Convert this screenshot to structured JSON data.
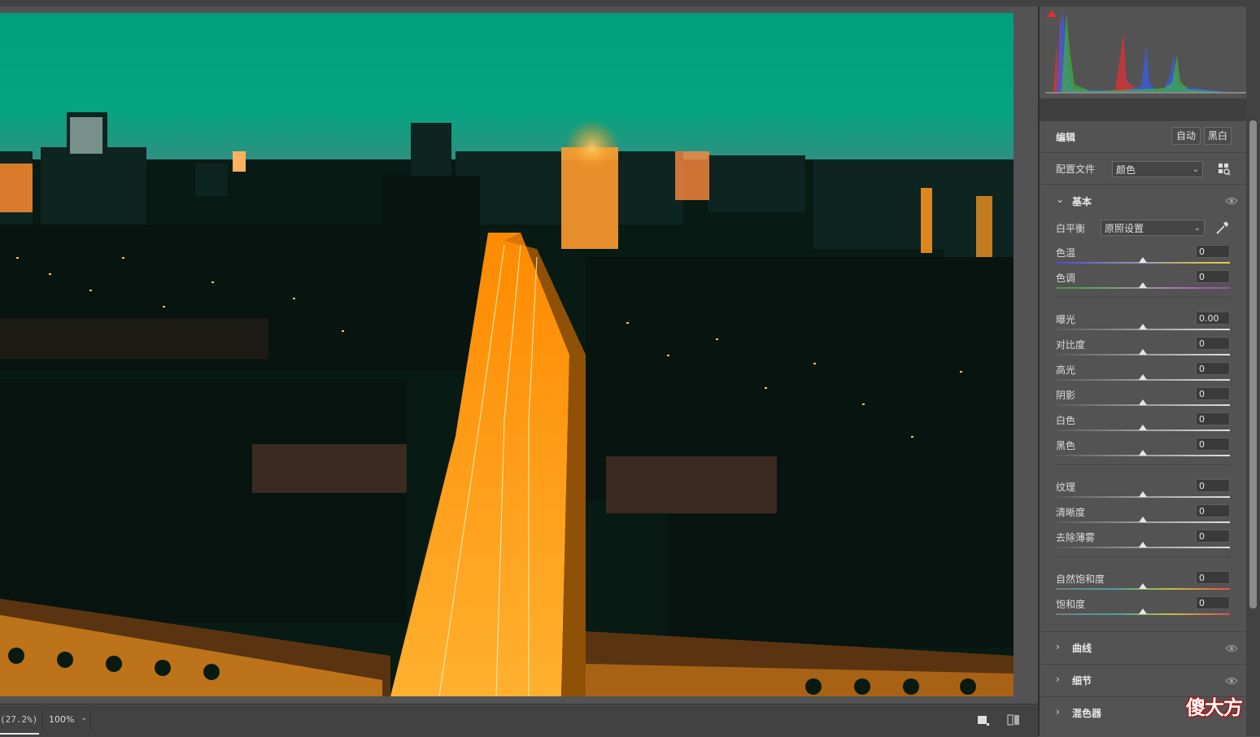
{
  "canvas": {
    "zoom_readout": "(27.2%)",
    "zoom_level": "100%"
  },
  "panel": {
    "edit_title": "编辑",
    "auto_button": "自动",
    "bw_button": "黑白",
    "profile_label": "配置文件",
    "profile_value": "颜色",
    "basic_section": "基本",
    "white_balance_label": "白平衡",
    "white_balance_value": "原照设置",
    "sliders": [
      {
        "label": "色温",
        "value": "0",
        "level": 0.5,
        "track": "temp"
      },
      {
        "label": "色调",
        "value": "0",
        "level": 0.5,
        "track": "tint"
      },
      {
        "label": "曝光",
        "value": "0.00",
        "level": 0.5,
        "track": "gray"
      },
      {
        "label": "对比度",
        "value": "0",
        "level": 0.5,
        "track": "gray"
      },
      {
        "label": "高光",
        "value": "0",
        "level": 0.5,
        "track": "gray"
      },
      {
        "label": "阴影",
        "value": "0",
        "level": 0.5,
        "track": "gray"
      },
      {
        "label": "白色",
        "value": "0",
        "level": 0.5,
        "track": "gray"
      },
      {
        "label": "黑色",
        "value": "0",
        "level": 0.5,
        "track": "gray"
      },
      {
        "label": "纹理",
        "value": "0",
        "level": 0.5,
        "track": "gray"
      },
      {
        "label": "清晰度",
        "value": "0",
        "level": 0.5,
        "track": "gray"
      },
      {
        "label": "去除薄雾",
        "value": "0",
        "level": 0.5,
        "track": "gray"
      },
      {
        "label": "自然饱和度",
        "value": "0",
        "level": 0.5,
        "track": "sat"
      },
      {
        "label": "饱和度",
        "value": "0",
        "level": 0.5,
        "track": "sat"
      }
    ],
    "collapsed_sections": [
      "曲线",
      "细节",
      "混色器"
    ]
  },
  "watermark": "傻大方",
  "icons": {
    "clip_shadow": "shadow-clipping-warning-icon",
    "clip_highlight": "highlight-clipping-warning-icon",
    "profile_browser": "grid-icon",
    "eyedropper": "eyedropper-icon",
    "visibility": "eye-icon",
    "view_single": "single-view-icon",
    "view_compare": "before-after-icon"
  },
  "colors": {
    "panel_bg": "#535353",
    "histogram_red": "#e03030",
    "histogram_green": "#3cc03c",
    "histogram_blue": "#3a5de0",
    "sky": "#00a07c",
    "city_glow": "#ff9a1a"
  }
}
